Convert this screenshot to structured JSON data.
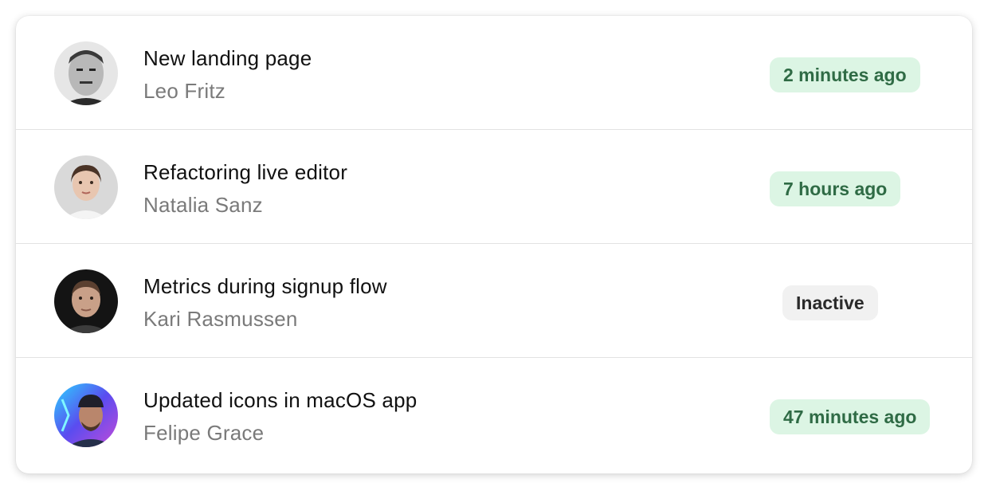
{
  "activity": {
    "items": [
      {
        "title": "New landing page",
        "name": "Leo Fritz",
        "status": "2 minutes ago",
        "status_type": "active",
        "avatar": "portrait-bw-man"
      },
      {
        "title": "Refactoring live editor",
        "name": "Natalia Sanz",
        "status": "7 hours ago",
        "status_type": "active",
        "avatar": "portrait-woman"
      },
      {
        "title": "Metrics during signup flow",
        "name": "Kari Rasmussen",
        "status": "Inactive",
        "status_type": "inactive",
        "avatar": "portrait-dark-man"
      },
      {
        "title": "Updated icons in macOS app",
        "name": "Felipe Grace",
        "status": "47 minutes ago",
        "status_type": "active",
        "avatar": "portrait-neon-man"
      }
    ]
  },
  "colors": {
    "active_badge_bg": "#dcf5e4",
    "active_badge_text": "#2f6b45",
    "inactive_badge_bg": "#f1f1f1",
    "inactive_badge_text": "#2a2a2a"
  }
}
